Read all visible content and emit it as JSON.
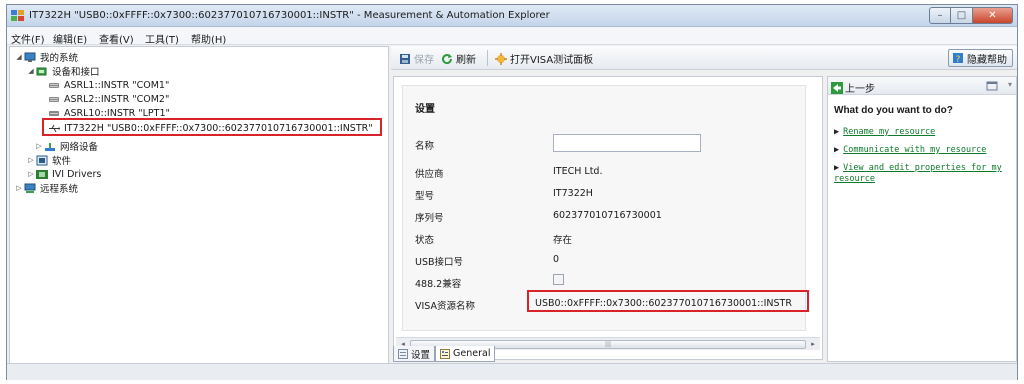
{
  "window": {
    "title": "IT7322H \"USB0::0xFFFF::0x7300::602377010716730001::INSTR\" - Measurement & Automation Explorer"
  },
  "menu": [
    {
      "label": "文件(F)"
    },
    {
      "label": "编辑(E)"
    },
    {
      "label": "查看(V)"
    },
    {
      "label": "工具(T)"
    },
    {
      "label": "帮助(H)"
    }
  ],
  "tree": {
    "my_system": "我的系统",
    "devices_interfaces": "设备和接口",
    "asrl1": "ASRL1::INSTR \"COM1\"",
    "asrl2": "ASRL2::INSTR \"COM2\"",
    "asrl10": "ASRL10::INSTR \"LPT1\"",
    "selected_device": "IT7322H \"USB0::0xFFFF::0x7300::602377010716730001::INSTR\"",
    "network_devices": "网络设备",
    "software": "软件",
    "ivi_drivers": "IVI Drivers",
    "remote_systems": "远程系统"
  },
  "toolbar": {
    "save": "保存",
    "refresh": "刷新",
    "open_visa_panel": "打开VISA测试面板",
    "hide_help": "隐藏帮助"
  },
  "settings": {
    "title": "设置",
    "rows": [
      {
        "label": "名称",
        "value": ""
      },
      {
        "label": "供应商",
        "value": "ITECH Ltd."
      },
      {
        "label": "型号",
        "value": "IT7322H"
      },
      {
        "label": "序列号",
        "value": "602377010716730001"
      },
      {
        "label": "状态",
        "value": "存在"
      },
      {
        "label": "USB接口号",
        "value": "0"
      },
      {
        "label": "488.2兼容",
        "value": ""
      },
      {
        "label": "VISA资源名称",
        "value": "USB0::0xFFFF::0x7300::602377010716730001::INSTR"
      }
    ]
  },
  "tabs": [
    {
      "label": "设置"
    },
    {
      "label": "General"
    }
  ],
  "help": {
    "back": "上一步",
    "question": "What do you want to do?",
    "links": [
      "Rename my resource",
      "Communicate with my resource",
      "View and edit properties for my resource"
    ]
  },
  "colors": {
    "highlight_box": "#d9232a",
    "help_link": "#0f7a2c"
  }
}
